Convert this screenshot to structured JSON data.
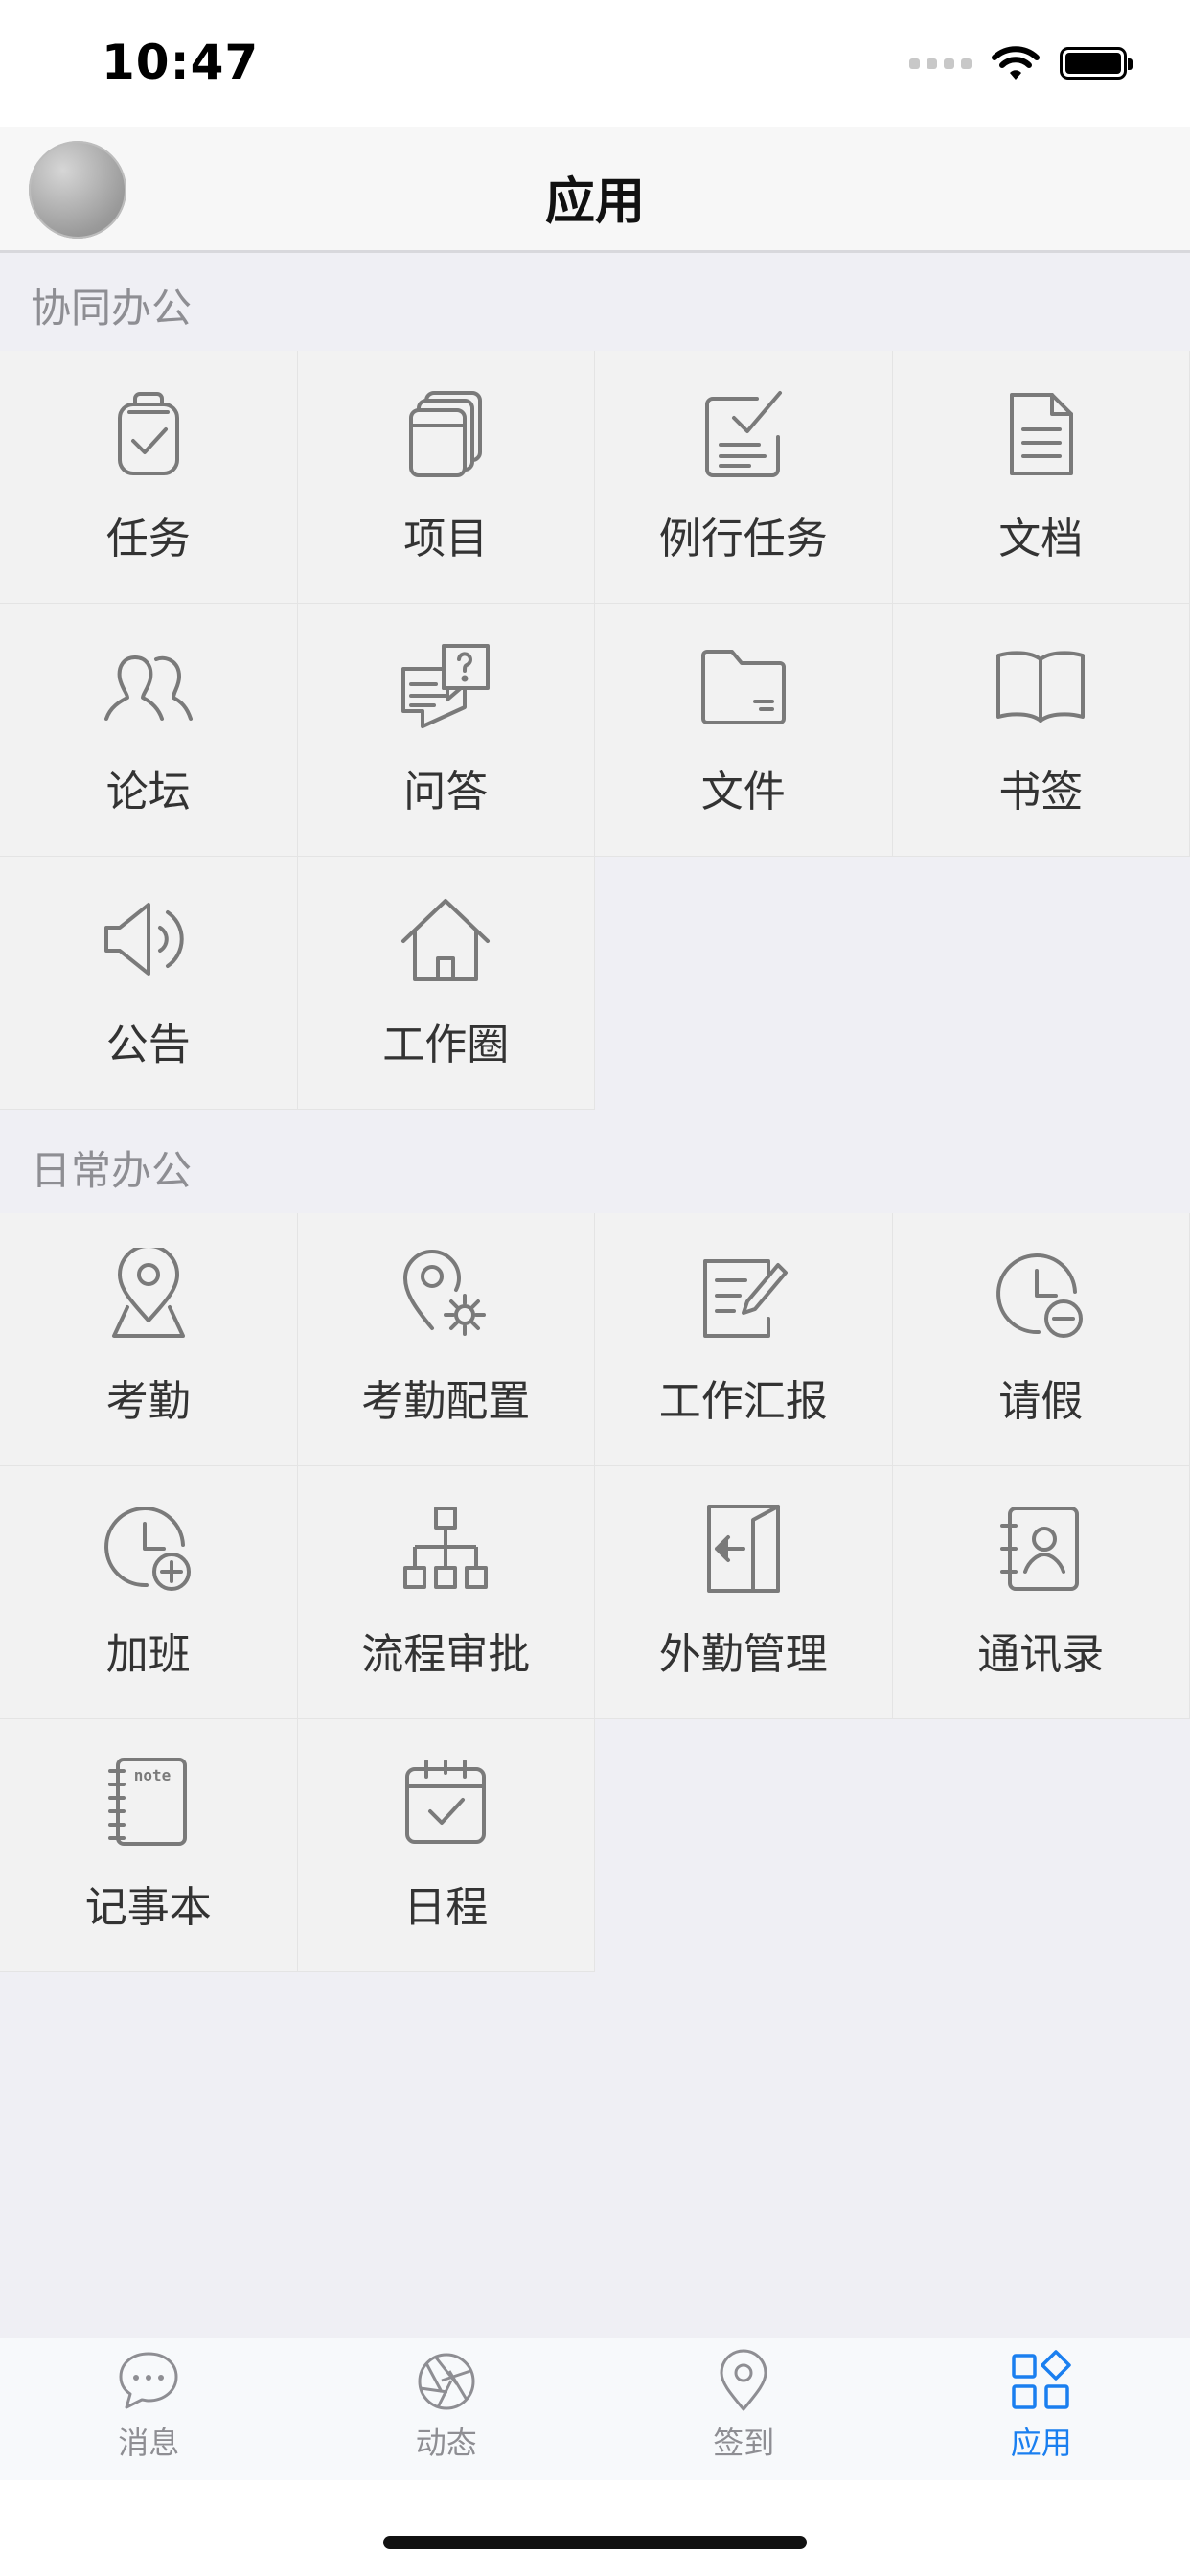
{
  "status_bar": {
    "time": "10:47"
  },
  "nav": {
    "title": "应用"
  },
  "sections": [
    {
      "title": "协同办公",
      "items": [
        {
          "label": "任务",
          "icon": "clipboard-check-icon"
        },
        {
          "label": "项目",
          "icon": "stacked-cards-icon"
        },
        {
          "label": "例行任务",
          "icon": "routine-checklist-icon"
        },
        {
          "label": "文档",
          "icon": "document-icon"
        },
        {
          "label": "论坛",
          "icon": "two-people-icon"
        },
        {
          "label": "问答",
          "icon": "question-message-icon"
        },
        {
          "label": "文件",
          "icon": "folder-icon"
        },
        {
          "label": "书签",
          "icon": "open-book-icon"
        },
        {
          "label": "公告",
          "icon": "speaker-icon"
        },
        {
          "label": "工作圈",
          "icon": "home-icon"
        }
      ]
    },
    {
      "title": "日常办公",
      "items": [
        {
          "label": "考勤",
          "icon": "map-pin-icon"
        },
        {
          "label": "考勤配置",
          "icon": "pin-settings-icon"
        },
        {
          "label": "工作汇报",
          "icon": "edit-document-icon"
        },
        {
          "label": "请假",
          "icon": "clock-minus-icon"
        },
        {
          "label": "加班",
          "icon": "clock-plus-icon"
        },
        {
          "label": "流程审批",
          "icon": "org-chart-icon"
        },
        {
          "label": "外勤管理",
          "icon": "exit-door-icon"
        },
        {
          "label": "通讯录",
          "icon": "contacts-icon"
        },
        {
          "label": "记事本",
          "icon": "notebook-icon",
          "icon_text": "note"
        },
        {
          "label": "日程",
          "icon": "calendar-check-icon"
        }
      ]
    }
  ],
  "tabs": [
    {
      "label": "消息",
      "icon": "chat-bubble-icon",
      "active": false
    },
    {
      "label": "动态",
      "icon": "aperture-icon",
      "active": false
    },
    {
      "label": "签到",
      "icon": "location-pin-icon",
      "active": false
    },
    {
      "label": "应用",
      "icon": "apps-grid-icon",
      "active": true
    }
  ],
  "colors": {
    "accent": "#1a7ff0",
    "icon_gray": "#7a7a7a",
    "background": "#efeff4",
    "cell": "#f2f2f2"
  }
}
